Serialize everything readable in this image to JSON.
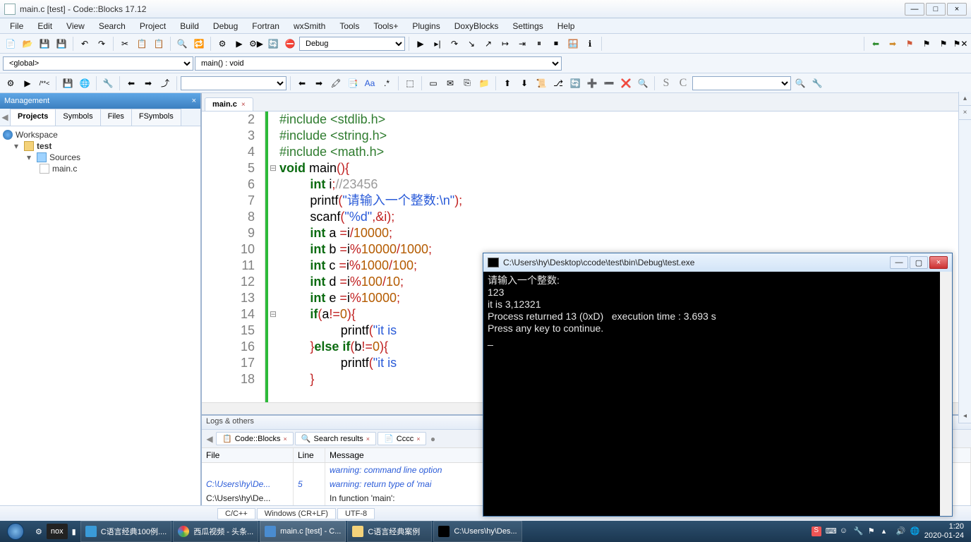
{
  "window": {
    "title": "main.c [test] - Code::Blocks 17.12",
    "min": "—",
    "max": "□",
    "close": "×"
  },
  "menus": [
    "File",
    "Edit",
    "View",
    "Search",
    "Project",
    "Build",
    "Debug",
    "Fortran",
    "wxSmith",
    "Tools",
    "Tools+",
    "Plugins",
    "DoxyBlocks",
    "Settings",
    "Help"
  ],
  "toolbar": {
    "build_target": "Debug",
    "scope": "<global>",
    "function": "main() : void"
  },
  "management": {
    "header": "Management",
    "tabs": [
      "Projects",
      "Symbols",
      "Files",
      "FSymbols"
    ],
    "active_tab": 0,
    "tree": {
      "workspace": "Workspace",
      "project": "test",
      "sources_folder": "Sources",
      "file": "main.c"
    }
  },
  "editor": {
    "tab_name": "main.c",
    "lines": [
      {
        "n": 2,
        "t": "#include <stdlib.h>",
        "cls": "pre"
      },
      {
        "n": 3,
        "t": "#include <string.h>",
        "cls": "pre"
      },
      {
        "n": 4,
        "t": "#include <math.h>",
        "cls": "pre"
      },
      {
        "n": 5,
        "raw": true
      },
      {
        "n": 6,
        "raw": true
      },
      {
        "n": 7,
        "raw": true
      },
      {
        "n": 8,
        "raw": true
      },
      {
        "n": 9,
        "raw": true
      },
      {
        "n": 10,
        "raw": true
      },
      {
        "n": 11,
        "raw": true
      },
      {
        "n": 12,
        "raw": true
      },
      {
        "n": 13,
        "raw": true
      },
      {
        "n": 14,
        "raw": true
      },
      {
        "n": 15,
        "raw": true
      },
      {
        "n": 16,
        "raw": true
      },
      {
        "n": 17,
        "raw": true
      },
      {
        "n": 18,
        "raw": true
      }
    ],
    "code": {
      "l5": {
        "kw1": "void",
        "id": " main",
        "op": "(){"
      },
      "l6": {
        "kw": "int",
        "id": " i",
        "op": ";",
        "cmt": "//23456"
      },
      "l7": {
        "fn": "printf",
        "op1": "(",
        "str": "\"请输入一个整数:\\n\"",
        "op2": ");"
      },
      "l8": {
        "fn": "scanf",
        "op1": "(",
        "str": "\"%d\"",
        "op2": ",&i);"
      },
      "l9": {
        "kw": "int",
        "id": " a ",
        "op1": "=",
        "id2": "i",
        "op2": "/",
        "num": "10000",
        "op3": ";"
      },
      "l10": {
        "kw": "int",
        "id": " b ",
        "op1": "=",
        "id2": "i",
        "op2": "%",
        "num": "10000",
        "op3": "/",
        "num2": "1000",
        "op4": ";"
      },
      "l11": {
        "kw": "int",
        "id": " c ",
        "op1": "=",
        "id2": "i",
        "op2": "%",
        "num": "1000",
        "op3": "/",
        "num2": "100",
        "op4": ";"
      },
      "l12": {
        "kw": "int",
        "id": " d ",
        "op1": "=",
        "id2": "i",
        "op2": "%",
        "num": "100",
        "op3": "/",
        "num2": "10",
        "op4": ";"
      },
      "l13": {
        "kw": "int",
        "id": " e ",
        "op1": "=",
        "id2": "i",
        "op2": "%",
        "num": "10000",
        "op3": ";"
      },
      "l14": {
        "kw": "if",
        "op1": "(",
        "id": "a",
        "op2": "!=",
        "num": "0",
        "op3": "){"
      },
      "l15": {
        "fn": "printf",
        "op1": "(",
        "str": "\"it is"
      },
      "l16": {
        "op1": "}",
        "kw": "else if",
        "op2": "(",
        "id": "b",
        "op3": "!=",
        "num": "0",
        "op4": "){"
      },
      "l17": {
        "fn": "printf",
        "op1": "(",
        "str": "\"it is"
      },
      "l18": {
        "op": "}"
      }
    }
  },
  "logs": {
    "header": "Logs & others",
    "tabs": [
      "Code::Blocks",
      "Search results",
      "Cccc"
    ],
    "cols": {
      "file": "File",
      "line": "Line",
      "msg": "Message"
    },
    "rows": [
      {
        "file": "",
        "line": "",
        "msg": "warning: command line option",
        "italic": true
      },
      {
        "file": "C:\\Users\\hy\\De...",
        "line": "5",
        "msg": "warning: return type of 'mai",
        "italic": true
      },
      {
        "file": "C:\\Users\\hy\\De...",
        "line": "",
        "msg": "In function 'main':",
        "italic": false
      }
    ]
  },
  "status": {
    "lang": "C/C++",
    "eol": "Windows (CR+LF)",
    "enc": "UTF-8"
  },
  "console": {
    "title": "C:\\Users\\hy\\Desktop\\ccode\\test\\bin\\Debug\\test.exe",
    "lines": [
      "请输入一个整数:",
      "123",
      "it is 3,12321",
      "Process returned 13 (0xD)   execution time : 3.693 s",
      "Press any key to continue.",
      "_"
    ]
  },
  "taskbar": {
    "tasks": [
      {
        "label": "C语言经典100例...."
      },
      {
        "label": "西瓜视频 - 头条..."
      },
      {
        "label": "main.c [test] - C...",
        "active": true
      },
      {
        "label": "C语言经典案例"
      },
      {
        "label": "C:\\Users\\hy\\Des..."
      }
    ],
    "time": "1:20",
    "date": "2020-01-24"
  }
}
